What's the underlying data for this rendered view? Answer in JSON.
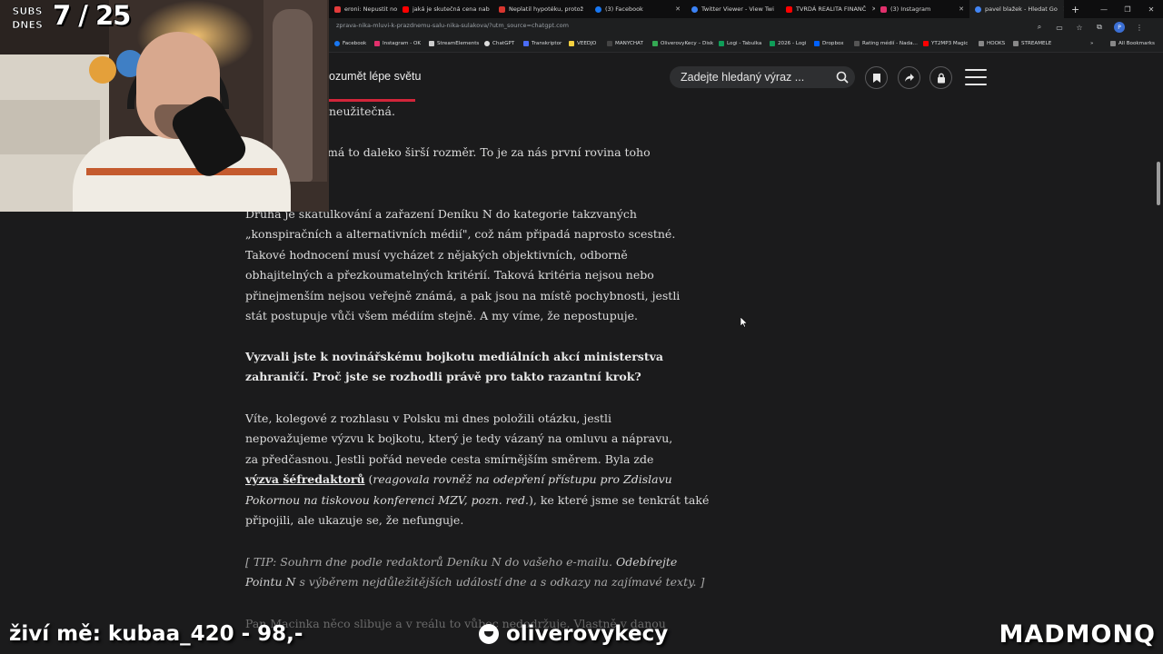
{
  "browser": {
    "tabs": [
      {
        "label": "eroni: Nepustit novin",
        "color": "#e33b3b"
      },
      {
        "label": "jaká je skutečná cena nab",
        "color": "#ff0000"
      },
      {
        "label": "Neplatil hypotéku, protož",
        "color": "#d9362f"
      },
      {
        "label": "(3) Facebook",
        "color": "#1877f2"
      },
      {
        "label": "Twitter Viewer - View Twi",
        "color": "#3b82f6"
      },
      {
        "label": "TVRDÁ REALITA FINANČ",
        "color": "#ff0000"
      },
      {
        "label": "(3) Instagram",
        "color": "#e1306c"
      },
      {
        "label": "pavel blažek - Hledat Go",
        "color": "#4285f4"
      }
    ],
    "url": "zprava-nika-mluvi-k-prazdnemu-salu-nika-sulakova/?utm_source=chatgpt.com",
    "bookmarks": [
      {
        "label": "Facebook",
        "color": "#1877f2"
      },
      {
        "label": "Instagram - OK",
        "color": "#e1306c"
      },
      {
        "label": "StreamElements",
        "color": "#cccccc"
      },
      {
        "label": "ChatGPT",
        "color": "#dddddd"
      },
      {
        "label": "Transkriptor",
        "color": "#4a6cf7"
      },
      {
        "label": "VEEDJO",
        "color": "#f4d03f"
      },
      {
        "label": "MANYCHAT",
        "color": "#222222"
      },
      {
        "label": "OliverovyKecy – Disk",
        "color": "#34a853"
      },
      {
        "label": "Logi - Tabulka",
        "color": "#0f9d58"
      },
      {
        "label": "2026 - Logi",
        "color": "#0f9d58"
      },
      {
        "label": "Dropbox",
        "color": "#0061fe"
      },
      {
        "label": "Rating médií - Nada...",
        "color": "#555555"
      },
      {
        "label": "YT2MP3 Magic",
        "color": "#ff0000"
      },
      {
        "label": "HOOKS",
        "color": "#888888"
      },
      {
        "label": "STREAMELE",
        "color": "#888888"
      }
    ],
    "all_bookmarks": "All Bookmarks"
  },
  "site": {
    "title": "ozumět lépe světu",
    "search_placeholder": "Zadejte hledaný výraz ..."
  },
  "article": {
    "lines": [
      "neužitečná.",
      "má to daleko širší rozměr. To je za nás první rovina toho",
      "Druhá je škatulkování a zařazení Deníku N do kategorie takzvaných",
      "„konspiračních a alternativních médií\", což nám připadá naprosto scestné.",
      "Takové hodnocení musí vycházet z nějakých objektivních, odborně",
      "obhajitelných a přezkoumatelných kritérií. Taková kritéria nejsou nebo",
      "přinejmenším nejsou veřejně známá, a pak jsou na místě pochybnosti, jestli",
      "stát postupuje vůči všem médiím stejně. A my víme, že nepostupuje.",
      "Vyzvali jste k novinářskému bojkotu mediálních akcí ministerstva",
      "zahraničí. Proč jste se rozhodli právě pro takto razantní krok?",
      "Víte, kolegové z rozhlasu v Polsku mi dnes položili otázku, jestli",
      "nepovažujeme výzvu k bojkotu, který je tedy vázaný na omluvu a nápravu,",
      "za předčasnou. Jestli pořád nevede cesta smírnějším směrem. Byla zde",
      "výzva šéfredaktorů",
      " (",
      "reagovala rovněž na odepření přístupu pro Zdislavu",
      "Pokornou na tiskovou konferenci MZV, pozn. red.",
      "), ke které jsme se tenkrát také",
      "připojili, ale ukazuje se, že nefunguje.",
      "[ TIP: Souhrn dne podle redaktorů Deníku N do vašeho e-mailu. ",
      "Odebírejte",
      "Pointu N",
      " s výběrem nejdůležitějších událostí dne a s odkazy na zajímavé texty. ]",
      "Pan Macinka něco slibuje a v reálu to vůbec nedodržuje. Vlastně v danou"
    ]
  },
  "stream": {
    "subs_label": "SUBS DNES",
    "subs_count": "7 / 25",
    "left_text": "živí mě: kubaa_420 - 98,-",
    "mid_text": "oliverovykecy",
    "right_text": "MADMONQ"
  }
}
